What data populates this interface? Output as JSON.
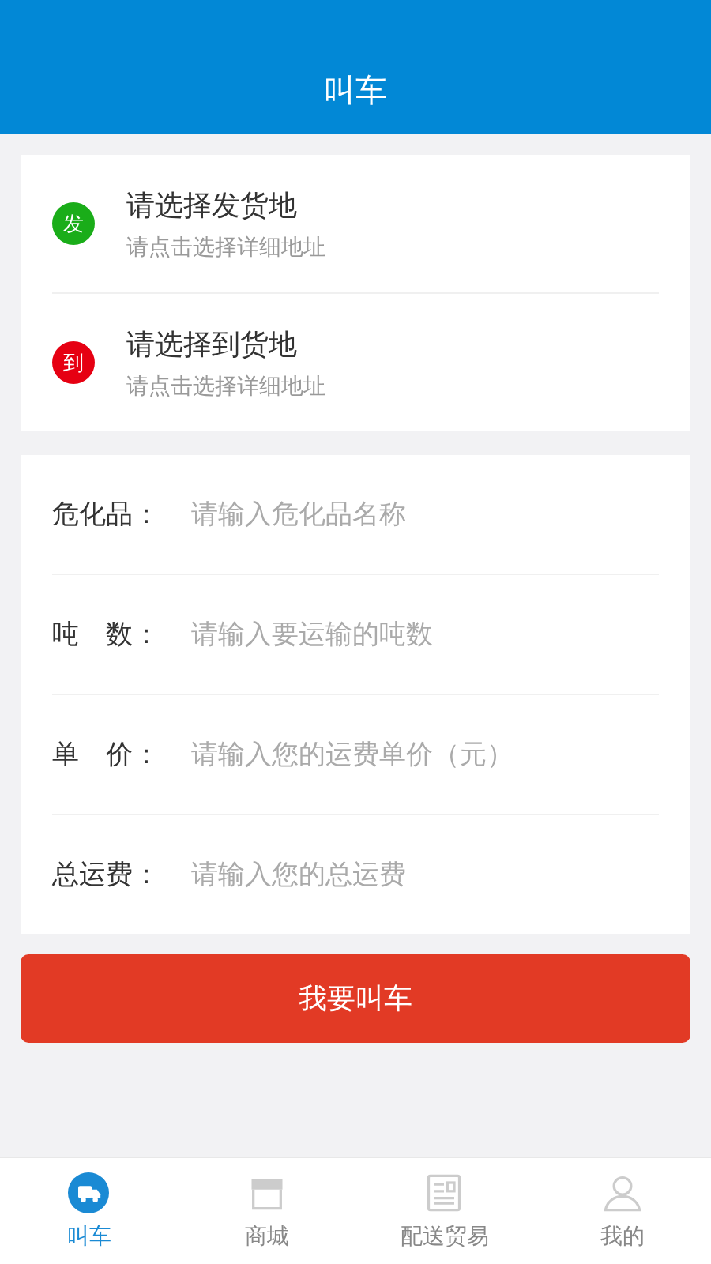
{
  "header": {
    "title": "叫车"
  },
  "locations": [
    {
      "badge": "发",
      "color": "#1aad19",
      "title": "请选择发货地",
      "hint": "请点击选择详细地址"
    },
    {
      "badge": "到",
      "color": "#e60012",
      "title": "请选择到货地",
      "hint": "请点击选择详细地址"
    }
  ],
  "fields": [
    {
      "label": "危化品：",
      "placeholder": "请输入危化品名称"
    },
    {
      "label": "吨　数：",
      "placeholder": "请输入要运输的吨数"
    },
    {
      "label": "单　价：",
      "placeholder": "请输入您的运费单价（元）"
    },
    {
      "label": "总运费：",
      "placeholder": "请输入您的总运费"
    }
  ],
  "submit_button": "我要叫车",
  "tab_bar": [
    {
      "kind": "truck",
      "label": "叫车",
      "selected": true
    },
    {
      "kind": "shop",
      "label": "商城",
      "selected": false
    },
    {
      "kind": "news",
      "label": "配送贸易",
      "selected": false
    },
    {
      "kind": "person",
      "label": "我的",
      "selected": false
    }
  ]
}
